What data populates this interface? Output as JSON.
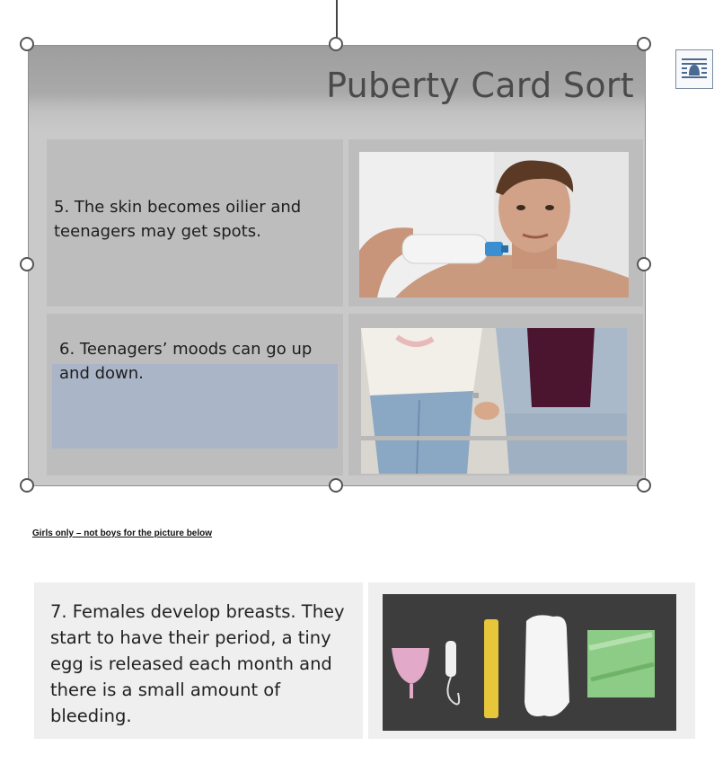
{
  "slide": {
    "title": "Puberty Card Sort",
    "cards": [
      {
        "text": "5. The skin becomes oilier and teenagers may get spots.",
        "image": "teen-applying-skincare-photo"
      },
      {
        "text": "6.  Teenagers’ moods can go up and down.",
        "image": "couple-holding-hands-photo"
      }
    ]
  },
  "layout_options_icon": "wrap-text-icon",
  "note": "Girls only – not boys for the picture below",
  "card7": {
    "text": "7. Females develop breasts. They start to have their period, a tiny egg is released each month and there is a small amount of bleeding.",
    "image": "period-products-photo"
  }
}
